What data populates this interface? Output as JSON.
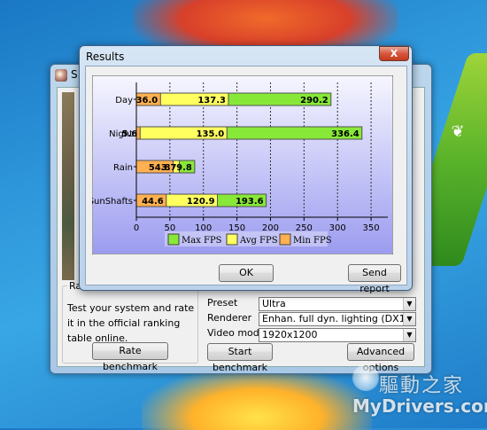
{
  "desktop": {
    "watermark_cn": "驅動之家",
    "watermark_en": "MyDrivers.com"
  },
  "main_window": {
    "title": "S.",
    "rank_group_title": "Ra",
    "rank_text": "Test your system and rate it in the official ranking table online.",
    "rate_button": "Rate benchmark",
    "preset_label": "Preset",
    "preset_value": "Ultra",
    "renderer_label": "Renderer",
    "renderer_value": "Enhan. full dyn. lighting (DX11)",
    "videomode_label": "Video mode",
    "videomode_value": "1920x1200",
    "start_button": "Start benchmark",
    "advanced_button": "Advanced options"
  },
  "results_dialog": {
    "title": "Results",
    "close_glyph": "X",
    "ok_button": "OK",
    "send_button": "Send report"
  },
  "colors": {
    "max_fps": "#88e838",
    "avg_fps": "#ffff60",
    "min_fps": "#ffb050",
    "plot_top": "#f6f6ff",
    "plot_bottom": "#9c9cf0"
  },
  "chart_data": {
    "type": "bar",
    "orientation": "horizontal",
    "stacked_overlay": true,
    "categories": [
      "Day",
      "Night",
      "Rain",
      "SunShafts"
    ],
    "series": [
      {
        "name": "Max FPS",
        "values": [
          290.2,
          336.4,
          9.8,
          193.6
        ],
        "labels": [
          "290.2",
          "336.4",
          "9.8",
          "193.6"
        ]
      },
      {
        "name": "Avg FPS",
        "values": [
          137.3,
          135.0,
          3.7,
          120.9
        ],
        "labels": [
          "137.3",
          "135.0",
          "3.7",
          "120.9"
        ]
      },
      {
        "name": "Min FPS",
        "values": [
          36.0,
          5.6,
          54.8,
          44.6
        ],
        "labels": [
          "36.0",
          "5.6",
          "54.8",
          "44.6"
        ]
      }
    ],
    "bar_ends": [
      [
        36.0,
        137.3,
        290.2
      ],
      [
        5.6,
        135.0,
        336.4
      ],
      [
        54.8,
        64.0,
        87.0
      ],
      [
        44.6,
        120.9,
        193.6
      ]
    ],
    "xlim": [
      0,
      375
    ],
    "xticks": [
      0,
      50,
      100,
      150,
      200,
      250,
      300,
      350
    ],
    "grid": true,
    "legend_position": "bottom"
  }
}
